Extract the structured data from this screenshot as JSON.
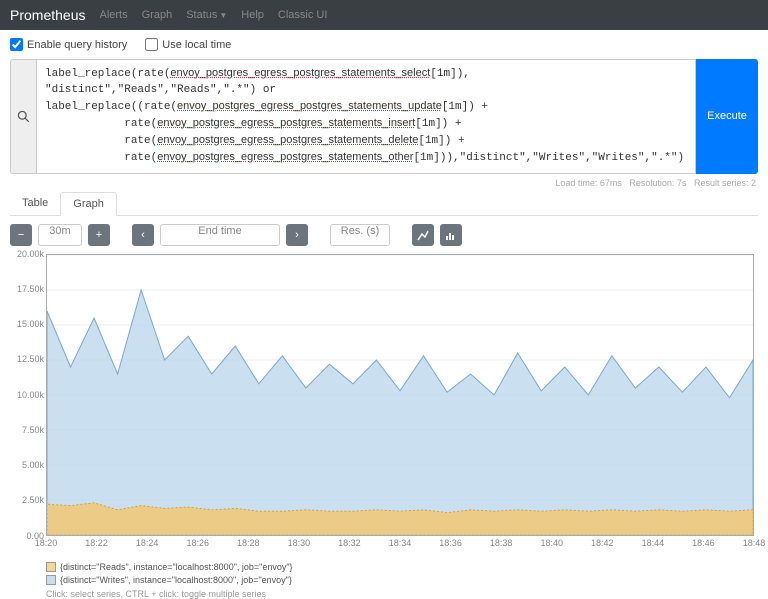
{
  "nav": {
    "brand": "Prometheus",
    "links": [
      "Alerts",
      "Graph",
      "Status",
      "Help",
      "Classic UI"
    ]
  },
  "opts": {
    "enable_history": "Enable query history",
    "enable_history_checked": true,
    "use_local": "Use local time",
    "use_local_checked": false
  },
  "query": {
    "lines": [
      "label_replace(rate(envoy_postgres_egress_postgres_statements_select[1m]), \"distinct\",\"Reads\",\"Reads\",\".*\") or",
      "label_replace((rate(envoy_postgres_egress_postgres_statements_update[1m]) +",
      "            rate(envoy_postgres_egress_postgres_statements_insert[1m]) +",
      "            rate(envoy_postgres_egress_postgres_statements_delete[1m]) +",
      "            rate(envoy_postgres_egress_postgres_statements_other[1m])),\"distinct\",\"Writes\",\"Writes\",\".*\")"
    ],
    "exec": "Execute"
  },
  "meta": {
    "load": "Load time: 67ms",
    "res": "Resolution: 7s",
    "series": "Result series: 2"
  },
  "tabs": [
    "Table",
    "Graph"
  ],
  "toolbar": {
    "range": "30m",
    "endtime": "End time",
    "res": "Res. (s)"
  },
  "chart_data": {
    "type": "area",
    "x_categories": [
      "18:20",
      "18:22",
      "18:24",
      "18:26",
      "18:28",
      "18:30",
      "18:32",
      "18:34",
      "18:36",
      "18:38",
      "18:40",
      "18:42",
      "18:44",
      "18:46",
      "18:48"
    ],
    "ylim": [
      0,
      20000
    ],
    "y_ticks": [
      0,
      2500,
      5000,
      7500,
      10000,
      12500,
      15000,
      17500,
      20000
    ],
    "y_tick_labels": [
      "0.00",
      "2.50k",
      "5.00k",
      "7.50k",
      "10.00k",
      "12.50k",
      "15.00k",
      "17.50k",
      "20.00k"
    ],
    "xlabel": "",
    "ylabel": "",
    "title": "",
    "series": [
      {
        "name": "Reads",
        "color": "#f0c97a",
        "values": [
          2200,
          2100,
          2300,
          1800,
          2100,
          1900,
          2000,
          1800,
          1900,
          1700,
          1700,
          1800,
          1700,
          1700,
          1800,
          1700,
          1800,
          1600,
          1800,
          1700,
          1800,
          1700,
          1800,
          1700,
          1800,
          1700,
          1800,
          1700,
          1800,
          1700,
          1800
        ]
      },
      {
        "name": "Writes",
        "color": "#b8d4ea",
        "values": [
          16000,
          12000,
          15500,
          11500,
          17500,
          12500,
          14200,
          11500,
          13500,
          10800,
          12800,
          10500,
          12200,
          10800,
          12500,
          10300,
          12800,
          10200,
          11500,
          10000,
          13000,
          10300,
          12000,
          10000,
          12800,
          10500,
          12000,
          10200,
          12000,
          9800,
          12500
        ]
      }
    ]
  },
  "legend": {
    "reads": "{distinct=\"Reads\", instance=\"localhost:8000\", job=\"envoy\"}",
    "writes": "{distinct=\"Writes\", instance=\"localhost:8000\", job=\"envoy\"}"
  },
  "hint": "Click: select series, CTRL + click: toggle multiple series"
}
